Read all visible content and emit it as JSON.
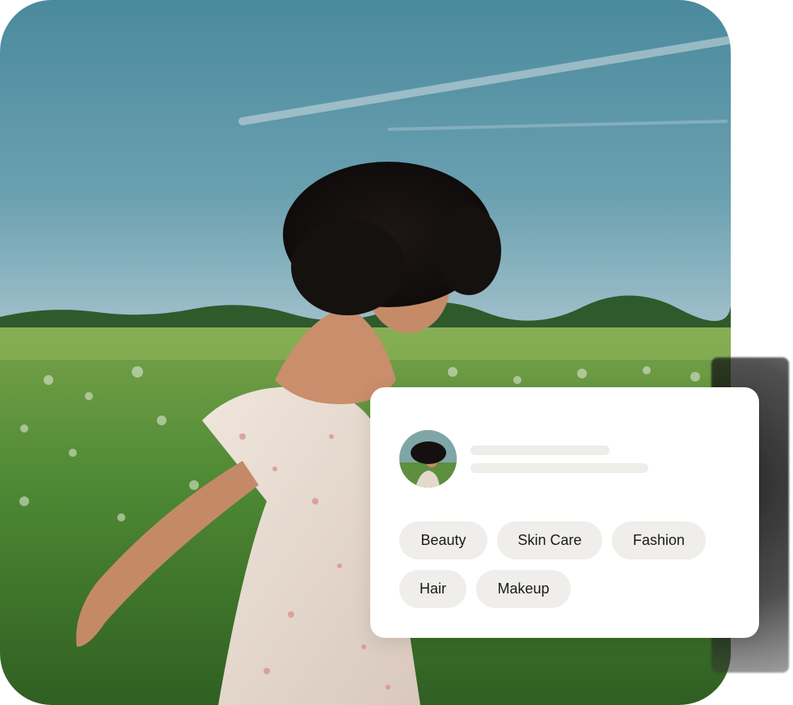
{
  "profile_card": {
    "tags": [
      "Beauty",
      "Skin Care",
      "Fashion",
      "Hair",
      "Makeup"
    ]
  },
  "colors": {
    "card_background": "#ffffff",
    "chip_background": "#efeeeb",
    "placeholder_line": "#eeede9",
    "sky": "#4f8ea0",
    "grass": "#5f8f3a"
  },
  "icons": {
    "avatar": "profile-avatar-photo"
  }
}
